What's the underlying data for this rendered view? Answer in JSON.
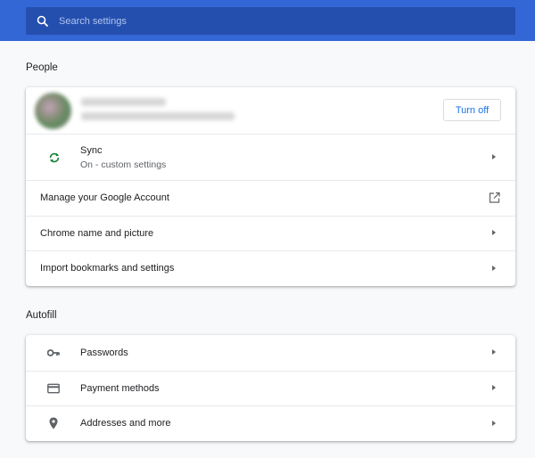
{
  "search": {
    "placeholder": "Search settings"
  },
  "people": {
    "title": "People",
    "turn_off_label": "Turn off",
    "sync": {
      "title": "Sync",
      "status": "On - custom settings"
    },
    "items": [
      {
        "label": "Manage your Google Account"
      },
      {
        "label": "Chrome name and picture"
      },
      {
        "label": "Import bookmarks and settings"
      }
    ]
  },
  "autofill": {
    "title": "Autofill",
    "items": [
      {
        "label": "Passwords",
        "icon": "key-icon"
      },
      {
        "label": "Payment methods",
        "icon": "credit-card-icon"
      },
      {
        "label": "Addresses and more",
        "icon": "location-pin-icon"
      }
    ]
  },
  "colors": {
    "header": "#3367d6",
    "search_bg": "#254fae",
    "accent": "#1a73e8",
    "sync_icon": "#188038"
  }
}
